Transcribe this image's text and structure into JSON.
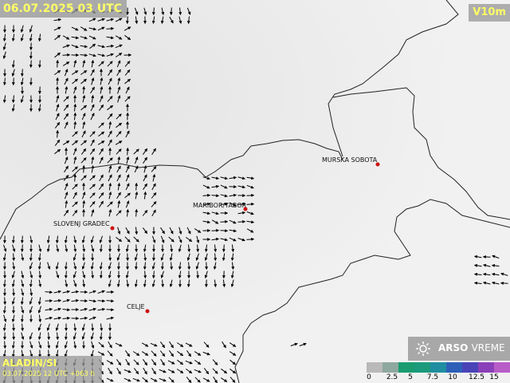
{
  "title": "06.07.2025 03 UTC",
  "parameter": "V10m",
  "model": {
    "name": "ALADIN/SI",
    "run": "03.07.2025 12 UTC +063 h"
  },
  "logo": {
    "bold": "ARSO",
    "light": "VREME"
  },
  "cities": [
    {
      "name": "MURSKA SOBOTA"
    },
    {
      "name": "MARIBOR/TABOR"
    },
    {
      "name": "SLOVENJ GRADEC"
    },
    {
      "name": "CELJE"
    }
  ],
  "scale": {
    "colors": [
      "#b9b9b9",
      "#8fa8a0",
      "#1a9c70",
      "#1b9a7c",
      "#1f8ea0",
      "#2d5fb8",
      "#4a43b8",
      "#8a40b8",
      "#b85cc8"
    ],
    "labels": [
      "0",
      "2.5",
      "5",
      "7.5",
      "10",
      "12.5",
      "15"
    ]
  },
  "colors": {
    "border": "#222222",
    "city_dot": "#cc1111",
    "label_text": "#ffff66"
  }
}
